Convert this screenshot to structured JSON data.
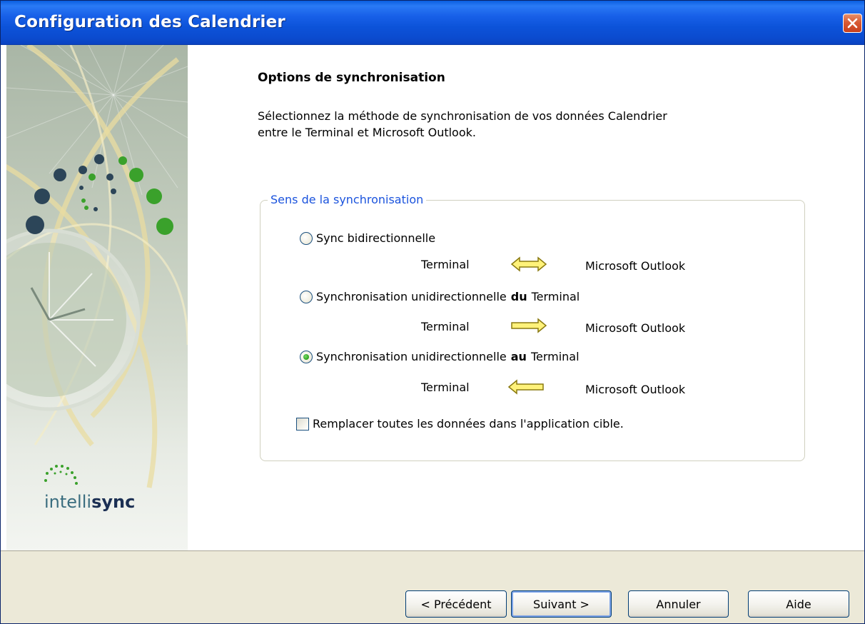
{
  "window": {
    "title": "Configuration des Calendrier",
    "close_icon": "close-icon"
  },
  "branding": {
    "logo_light": "intelli",
    "logo_bold": "sync"
  },
  "page": {
    "heading": "Options de synchronisation",
    "description_line1": "Sélectionnez la méthode de synchronisation de vos données Calendrier",
    "description_line2": "entre le Terminal et Microsoft Outlook."
  },
  "sync_group": {
    "legend": "Sens de la synchronisation",
    "options": [
      {
        "label": "Sync bidirectionnelle",
        "label_bold": "",
        "label_suffix": "",
        "checked": false,
        "left": "Terminal",
        "right": "Microsoft Outlook",
        "arrow": "double-arrow-icon"
      },
      {
        "label": "Synchronisation unidirectionnelle",
        "label_bold": "du",
        "label_suffix": "Terminal",
        "checked": false,
        "left": "Terminal",
        "right": "Microsoft Outlook",
        "arrow": "right-arrow-icon"
      },
      {
        "label": "Synchronisation unidirectionnelle",
        "label_bold": "au",
        "label_suffix": "Terminal",
        "checked": true,
        "left": "Terminal",
        "right": "Microsoft Outlook",
        "arrow": "left-arrow-icon"
      }
    ],
    "replace_all": {
      "label": "Remplacer toutes les données dans l'application cible.",
      "checked": false
    }
  },
  "buttons": {
    "back": "< Précédent",
    "next": "Suivant >",
    "cancel": "Annuler",
    "help": "Aide"
  },
  "colors": {
    "titlebar": "#0c53d9",
    "legend": "#1a53dd",
    "arrow_fill": "#fff27a",
    "radio_check": "#2aa31a"
  }
}
